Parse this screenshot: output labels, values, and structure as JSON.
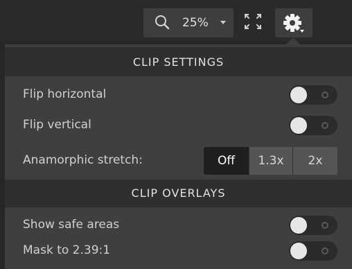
{
  "toolbar": {
    "zoom_value": "25%",
    "icons": [
      "search-icon",
      "fullscreen-icon",
      "gear-icon"
    ]
  },
  "clip_settings": {
    "header": "CLIP SETTINGS",
    "flip_horizontal": {
      "label": "Flip horizontal",
      "on": false
    },
    "flip_vertical": {
      "label": "Flip vertical",
      "on": false
    },
    "anamorphic": {
      "label": "Anamorphic stretch:",
      "options": [
        "Off",
        "1.3x",
        "2x"
      ],
      "selected": "Off"
    }
  },
  "clip_overlays": {
    "header": "CLIP OVERLAYS",
    "safe_areas": {
      "label": "Show safe areas",
      "on": false
    },
    "mask": {
      "label": "Mask to 2.39:1",
      "on": false
    }
  },
  "colors": {
    "background": "#262626",
    "panel": "#3f3f3f",
    "header": "#2f2f2f",
    "active_segment": "#1f1f1f"
  }
}
